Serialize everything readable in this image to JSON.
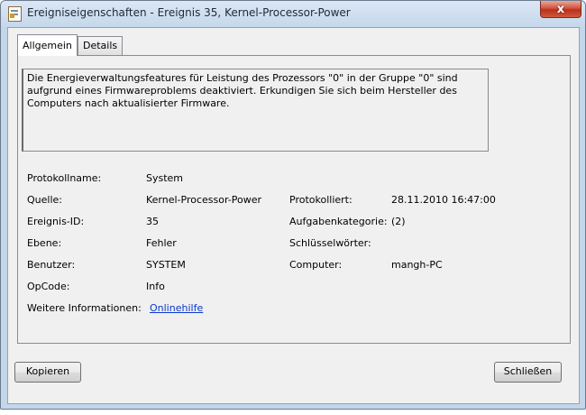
{
  "window": {
    "title": "Ereigniseigenschaften - Ereignis 35, Kernel-Processor-Power",
    "close_label": "x"
  },
  "tabs": [
    {
      "label": "Allgemein",
      "active": true
    },
    {
      "label": "Details",
      "active": false
    }
  ],
  "description": "Die Energieverwaltungsfeatures für Leistung des Prozessors \"0\" in der Gruppe \"0\" sind aufgrund eines Firmwareproblems deaktiviert. Erkundigen Sie sich beim Hersteller des Computers nach aktualisierter Firmware.",
  "fields": {
    "protokollname": {
      "label": "Protokollname:",
      "value": "System"
    },
    "quelle": {
      "label": "Quelle:",
      "value": "Kernel-Processor-Power"
    },
    "protokolliert": {
      "label": "Protokolliert:",
      "value": "28.11.2010 16:47:00"
    },
    "ereignis_id": {
      "label": "Ereignis-ID:",
      "value": "35"
    },
    "aufgabenkategorie": {
      "label": "Aufgabenkategorie:",
      "value": "(2)"
    },
    "ebene": {
      "label": "Ebene:",
      "value": "Fehler"
    },
    "schluesselwoerter": {
      "label": "Schlüsselwörter:",
      "value": ""
    },
    "benutzer": {
      "label": "Benutzer:",
      "value": "SYSTEM"
    },
    "computer": {
      "label": "Computer:",
      "value": "mangh-PC"
    },
    "opcode": {
      "label": "OpCode:",
      "value": "Info"
    },
    "weitere": {
      "label": "Weitere Informationen:",
      "link": "Onlinehilfe"
    }
  },
  "nav": {
    "up_icon": "arrow-up-icon",
    "down_icon": "arrow-down-icon"
  },
  "buttons": {
    "copy": "Kopieren",
    "close": "Schließen"
  }
}
